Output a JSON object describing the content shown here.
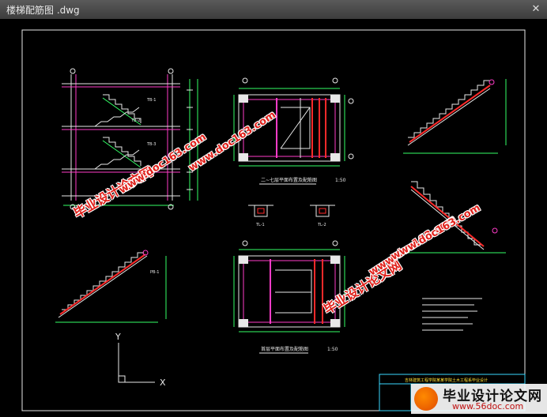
{
  "window": {
    "title": "楼梯配筋图 .dwg",
    "close_glyph": "✕"
  },
  "drawing": {
    "plan_upper_caption": "二~七层平面布置及配筋图",
    "plan_upper_scale": "1:50",
    "plan_ground_caption": "首层平面布置及配筋图",
    "plan_ground_scale": "1:50",
    "section_labels": [
      "TB-1",
      "TB-2",
      "TB-3",
      "TL-1",
      "TL-2",
      "PB-1"
    ],
    "ucs_x": "X",
    "ucs_y": "Y",
    "title_block_text": "吉林建筑工程学院某某学院土木工程系毕业设计"
  },
  "watermarks": {
    "site_cn": "毕业设计论文网",
    "site_url": "www.doc163.com"
  },
  "brand": {
    "name": "毕业设计论文网",
    "url": "www.56doc.com"
  },
  "colors": {
    "background": "#000000",
    "line_white": "#e8e8e8",
    "line_magenta": "#ff3cc8",
    "line_green": "#33ff66",
    "line_red": "#ff2a2a",
    "line_cyan": "#3ad8ff",
    "line_yellow": "#ffe033",
    "watermark_red": "#e0221c"
  }
}
